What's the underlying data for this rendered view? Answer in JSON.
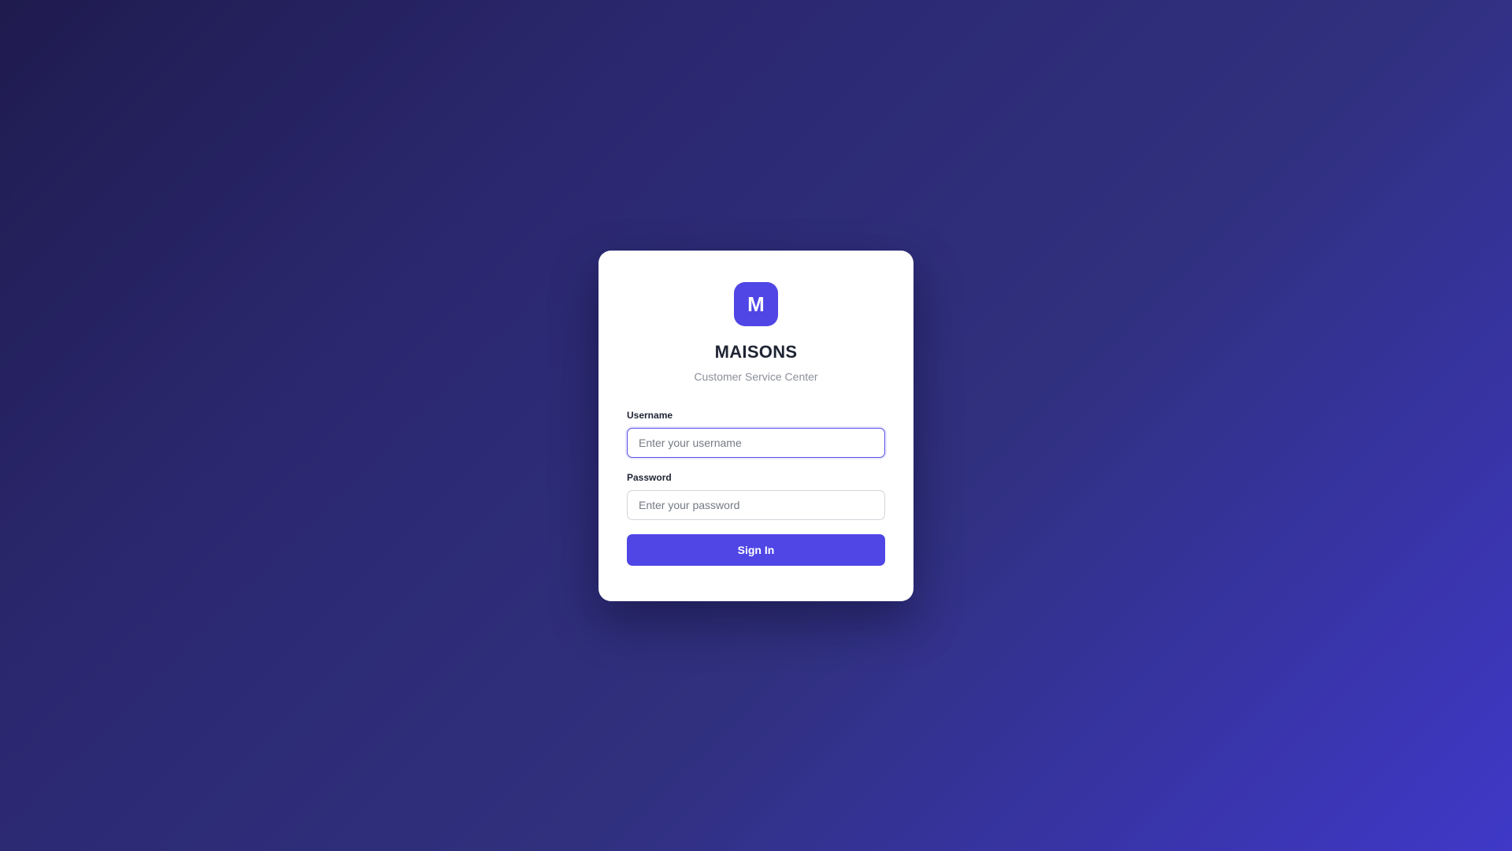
{
  "brand": {
    "logo_letter": "M",
    "name": "MAISONS",
    "subtitle": "Customer Service Center"
  },
  "form": {
    "username": {
      "label": "Username",
      "placeholder": "Enter your username",
      "value": ""
    },
    "password": {
      "label": "Password",
      "placeholder": "Enter your password",
      "value": ""
    },
    "submit_label": "Sign In"
  },
  "colors": {
    "accent": "#4f46e5",
    "background_start": "#1f1b4f",
    "background_end": "#3f38c8",
    "text_dark": "#1f2433",
    "text_muted": "#8b8f99"
  }
}
